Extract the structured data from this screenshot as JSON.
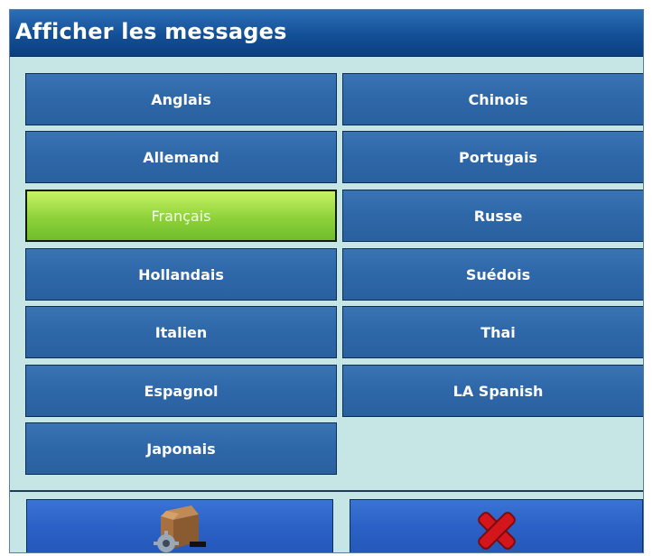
{
  "title": "Afficher les messages",
  "languages": {
    "left": [
      {
        "label": "Anglais",
        "selected": false
      },
      {
        "label": "Allemand",
        "selected": false
      },
      {
        "label": "Français",
        "selected": true
      },
      {
        "label": "Hollandais",
        "selected": false
      },
      {
        "label": "Italien",
        "selected": false
      },
      {
        "label": "Espagnol",
        "selected": false
      },
      {
        "label": "Japonais",
        "selected": false
      }
    ],
    "right": [
      {
        "label": "Chinois",
        "selected": false
      },
      {
        "label": "Portugais",
        "selected": false
      },
      {
        "label": "Russe",
        "selected": false
      },
      {
        "label": "Suédois",
        "selected": false
      },
      {
        "label": "Thai",
        "selected": false
      },
      {
        "label": "LA Spanish",
        "selected": false
      }
    ]
  },
  "footer": {
    "left_icon": "settings-box-icon",
    "right_icon": "close-x-icon"
  },
  "colors": {
    "background": "#c6e6e6",
    "title_bar": "#144f96",
    "button": "#2e67a8",
    "selected_button": "#8ed23a",
    "footer_button": "#2b61c6",
    "close_red": "#d4161c"
  }
}
